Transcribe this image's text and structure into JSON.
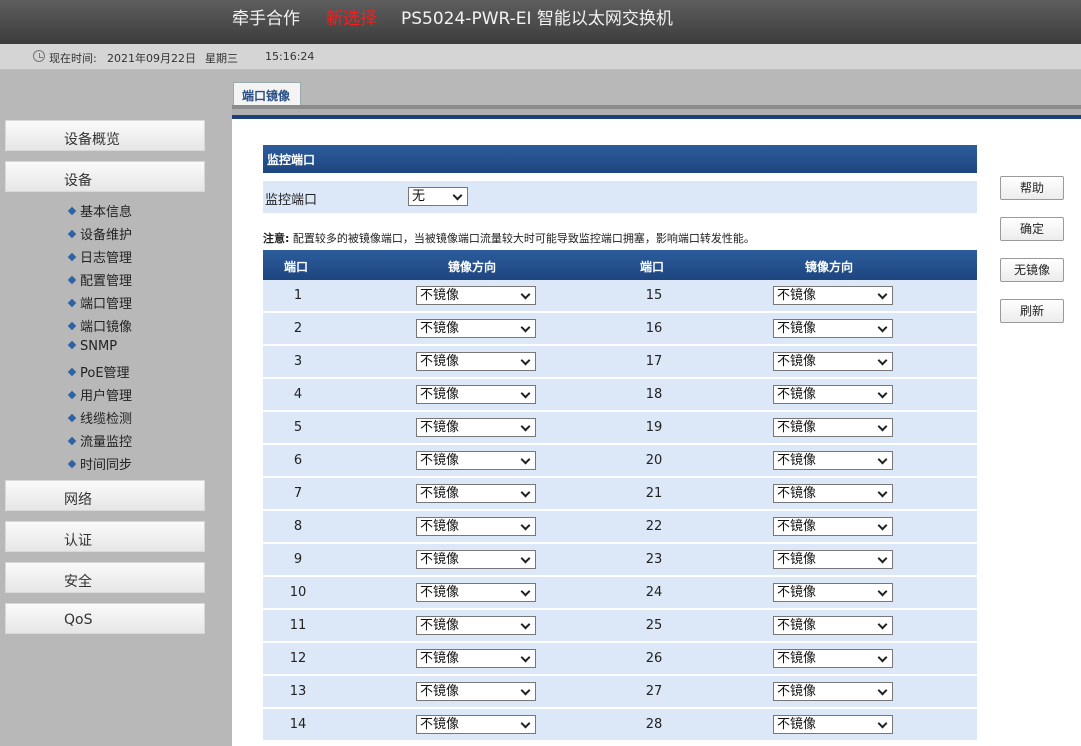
{
  "header": {
    "brand": "牵手合作",
    "brand_highlight": "新选择",
    "model": "PS5024-PWR-EI 智能以太网交换机"
  },
  "timebar": {
    "label": "现在时间:",
    "date": "2021年09月22日",
    "weekday": "星期三",
    "time": "15:16:24"
  },
  "sidebar": {
    "overview": "设备概览",
    "device": "设备",
    "subitems": [
      "基本信息",
      "设备维护",
      "日志管理",
      "配置管理",
      "端口管理",
      "端口镜像",
      "SNMP",
      "PoE管理",
      "用户管理",
      "线缆检测",
      "流量监控",
      "时间同步"
    ],
    "network": "网络",
    "auth": "认证",
    "security": "安全",
    "qos": "QoS"
  },
  "tab": {
    "label": "端口镜像"
  },
  "section": {
    "title": "监控端口",
    "monitor_label": "监控端口",
    "monitor_value": "无"
  },
  "note": {
    "prefix": "注意:",
    "text": "配置较多的被镜像端口，当被镜像端口流量较大时可能导致监控端口拥塞，影响端口转发性能。"
  },
  "table": {
    "col_port": "端口",
    "col_dir": "镜像方向",
    "left_ports": [
      "1",
      "2",
      "3",
      "4",
      "5",
      "6",
      "7",
      "8",
      "9",
      "10",
      "11",
      "12",
      "13",
      "14"
    ],
    "right_ports": [
      "15",
      "16",
      "17",
      "18",
      "19",
      "20",
      "21",
      "22",
      "23",
      "24",
      "25",
      "26",
      "27",
      "28"
    ],
    "direction_value": "不镜像"
  },
  "actions": {
    "help": "帮助",
    "ok": "确定",
    "no_mirror": "无镜像",
    "refresh": "刷新"
  },
  "colors": {
    "header_blue": "#1d4580",
    "row_blue": "#dce8f8",
    "brand_red": "#ff1a1a"
  }
}
